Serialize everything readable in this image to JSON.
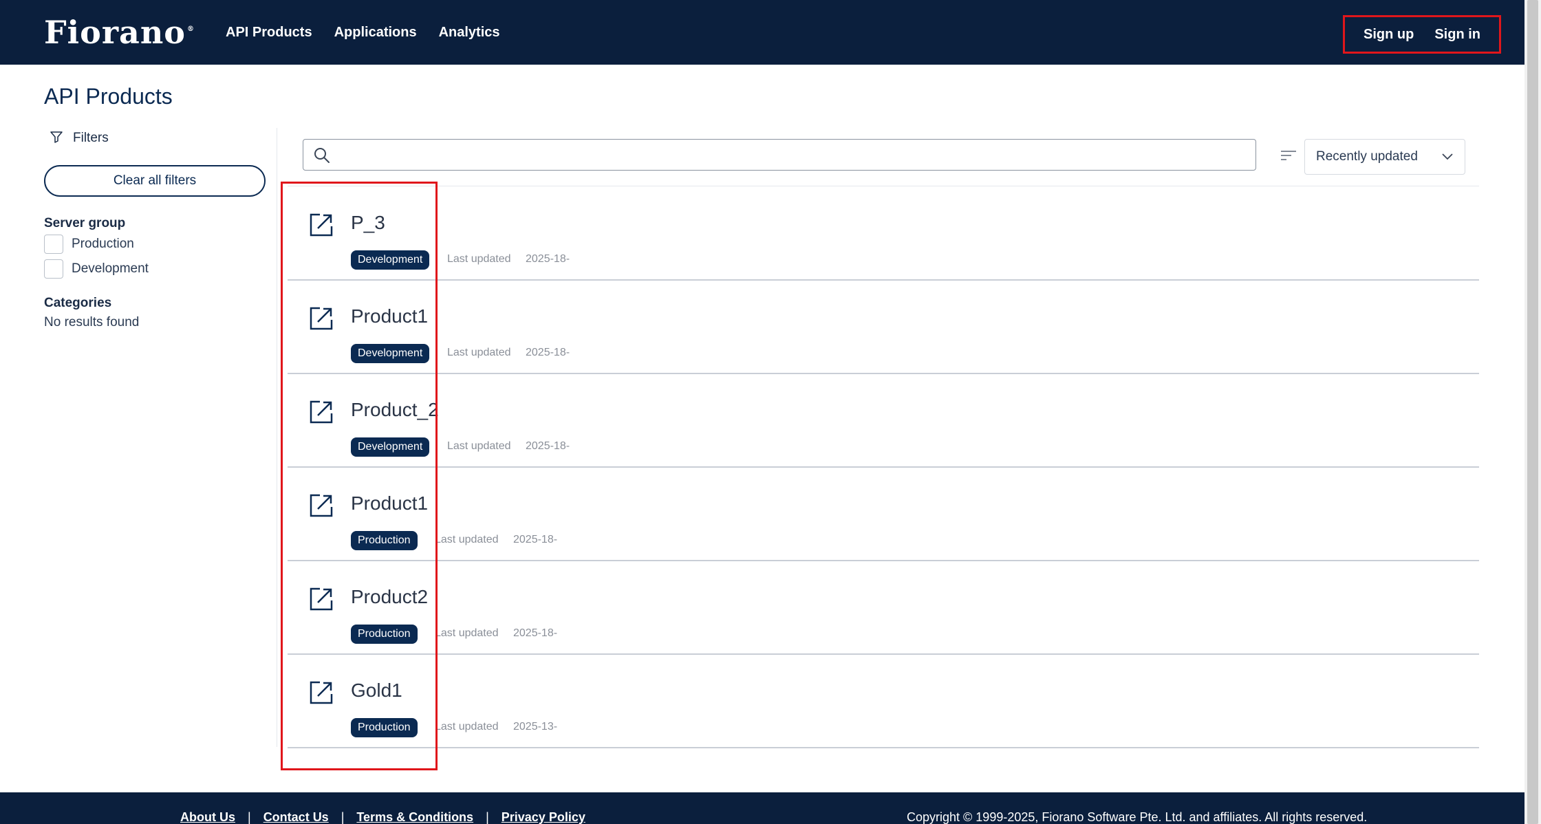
{
  "header": {
    "logo_text": "Fiorano",
    "logo_mark": "®",
    "nav": [
      "API Products",
      "Applications",
      "Analytics"
    ],
    "sign_up": "Sign up",
    "sign_in": "Sign in"
  },
  "page": {
    "title": "API Products"
  },
  "sidebar": {
    "filters_label": "Filters",
    "clear_all": "Clear all filters",
    "server_group_title": "Server group",
    "server_groups": [
      "Production",
      "Development"
    ],
    "categories_title": "Categories",
    "categories_empty": "No results found"
  },
  "toolbar": {
    "search_value": "",
    "sort_selected": "Recently updated"
  },
  "products": [
    {
      "name": "P_3",
      "server_group": "Development",
      "updated_label": "Last updated",
      "updated_date": "2025-18-"
    },
    {
      "name": "Product1",
      "server_group": "Development",
      "updated_label": "Last updated",
      "updated_date": "2025-18-"
    },
    {
      "name": "Product_2",
      "server_group": "Development",
      "updated_label": "Last updated",
      "updated_date": "2025-18-"
    },
    {
      "name": "Product1",
      "server_group": "Production",
      "updated_label": "Last updated",
      "updated_date": "2025-18-"
    },
    {
      "name": "Product2",
      "server_group": "Production",
      "updated_label": "Last updated",
      "updated_date": "2025-18-"
    },
    {
      "name": "Gold1",
      "server_group": "Production",
      "updated_label": "Last updated",
      "updated_date": "2025-13-"
    }
  ],
  "footer": {
    "links": [
      "About Us",
      "Contact Us",
      "Terms & Conditions",
      "Privacy Policy"
    ],
    "separator": "|",
    "copyright": "Copyright © 1999-2025, Fiorano Software Pte. Ltd. and affiliates. All rights reserved."
  },
  "colors": {
    "navy": "#0b1f3d",
    "badge": "#0b2a52",
    "highlight": "#e0161b"
  },
  "icons": [
    "filter-icon",
    "search-icon",
    "sort-icon",
    "chevron-down-icon",
    "external-link-icon"
  ]
}
